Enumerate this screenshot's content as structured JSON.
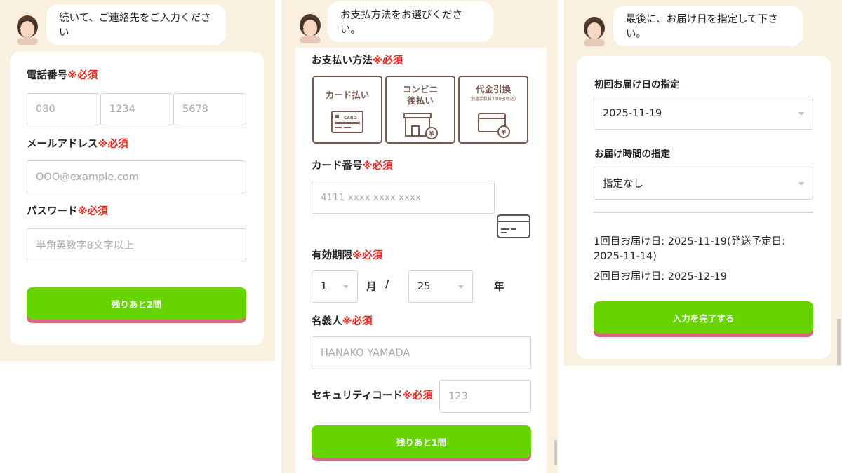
{
  "panel1": {
    "bubble": "続いて、ご連絡先をご入力ください",
    "phone": {
      "label": "電話番号",
      "required": "※必須",
      "placeholders": [
        "080",
        "1234",
        "5678"
      ]
    },
    "email": {
      "label": "メールアドレス",
      "required": "※必須",
      "placeholder": "OOO@example.com"
    },
    "password": {
      "label": "パスワード",
      "required": "※必須",
      "placeholder": "半角英数字8文字以上"
    },
    "button": "残りあと2問"
  },
  "panel2": {
    "bubble": "お支払方法をお選びください。",
    "payment": {
      "label": "お支払い方法",
      "required": "※必須",
      "options": [
        {
          "line1": "カード払い",
          "line2": "",
          "note": "",
          "icon": "credit-card-icon",
          "card_text": "CARD"
        },
        {
          "line1": "コンビニ",
          "line2": "後払い",
          "note": "",
          "icon": "convenience-store-icon"
        },
        {
          "line1": "代金引換",
          "line2": "",
          "note": "別途手数料330円(税込)",
          "icon": "cash-on-delivery-icon"
        }
      ]
    },
    "card_number": {
      "label": "カード番号",
      "required": "※必須",
      "placeholder": "4111 xxxx xxxx xxxx"
    },
    "expiry": {
      "label": "有効期限",
      "required": "※必須",
      "month": "1",
      "month_unit": "月",
      "sep": "/",
      "year": "25",
      "year_unit": "年"
    },
    "holder": {
      "label": "名義人",
      "required": "※必須",
      "placeholder": "HANAKO YAMADA"
    },
    "security": {
      "label": "セキュリティコード",
      "required": "※必須",
      "placeholder": "123"
    },
    "button": "残りあと1問"
  },
  "panel3": {
    "bubble": "最後に、お届け日を指定して下さい。",
    "first_date": {
      "label": "初回お届け日の指定",
      "value": "2025-11-19"
    },
    "time": {
      "label": "お届け時間の指定",
      "value": "指定なし"
    },
    "summary": [
      "1回目お届け日: 2025-11-19(発送予定日:",
      "2025-11-14)",
      "2回目お届け日: 2025-12-19"
    ],
    "button": "入力を完了する"
  },
  "colors": {
    "accent_green": "#66d400",
    "button_shadow": "#d9677d",
    "required_red": "#e8261c",
    "brown": "#7a5a50",
    "beige": "#faf0e0"
  }
}
